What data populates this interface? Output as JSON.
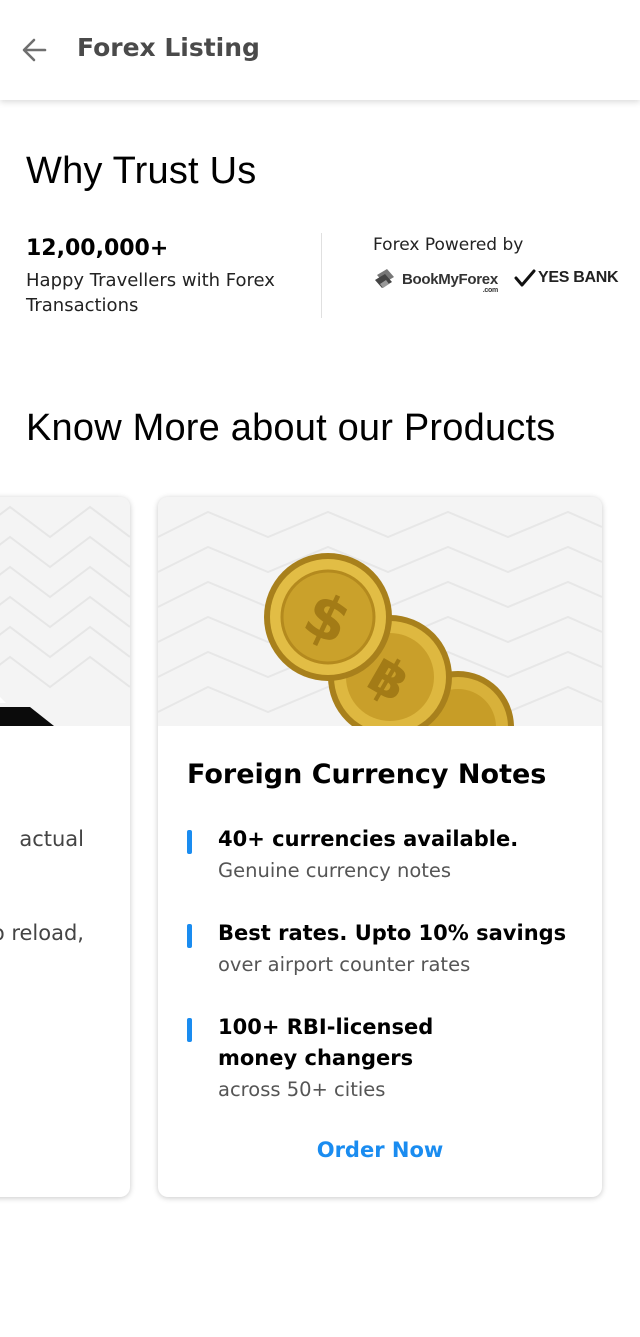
{
  "header": {
    "title": "Forex Listing"
  },
  "trust": {
    "title": "Why Trust Us",
    "stat_number": "12,00,000+",
    "stat_caption": "Happy Travellers with Forex Transactions",
    "powered_by_label": "Forex Powered by",
    "partner_1": "BookMyForex",
    "partner_1_suffix": ".com",
    "partner_2": "YES BANK"
  },
  "products": {
    "title": "Know More about our Products",
    "left_card": {
      "text_line_1": "actual",
      "text_line_2": "o reload,"
    },
    "card": {
      "title": "Foreign Currency Notes",
      "features": [
        {
          "head": "40+ currencies available.",
          "sub": "Genuine currency notes"
        },
        {
          "head": "Best rates. Upto 10% savings",
          "sub": "over airport counter rates"
        },
        {
          "head": "100+ RBI-licensed money changers",
          "sub": "across 50+ cities"
        }
      ],
      "cta": "Order Now"
    }
  },
  "colors": {
    "accent": "#1a8cf0",
    "gold": "#c9a227"
  }
}
